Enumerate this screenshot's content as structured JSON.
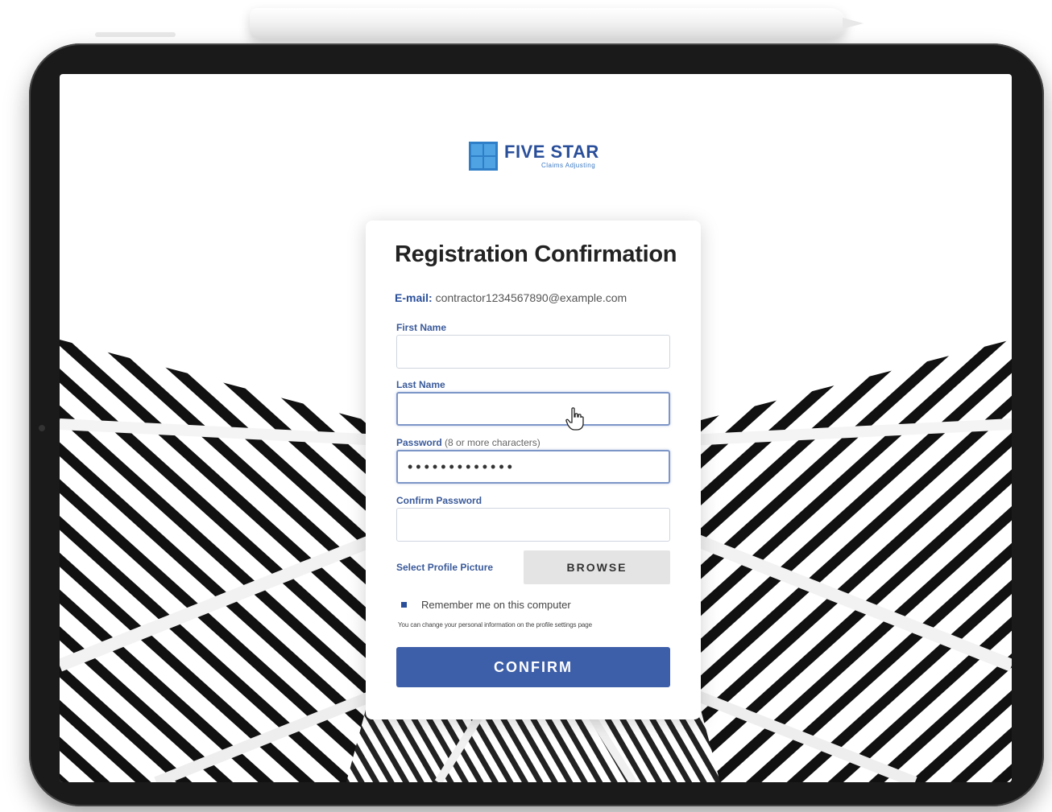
{
  "brand": {
    "name": "FIVE STAR",
    "tagline": "Claims Adjusting",
    "primary_color": "#2a4f9a",
    "accent_color": "#3d5ea8"
  },
  "form": {
    "title": "Registration Confirmation",
    "email_label": "E-mail:",
    "email_value": "contractor1234567890@example.com",
    "first_name_label": "First Name",
    "first_name_value": "",
    "last_name_label": "Last Name",
    "last_name_value": "",
    "password_label": "Password",
    "password_hint": "(8 or more characters)",
    "password_value": "•••••••••••••",
    "confirm_password_label": "Confirm Password",
    "confirm_password_value": "",
    "profile_picture_label": "Select Profile Picture",
    "browse_label": "BROWSE",
    "remember_label": "Remember me on this computer",
    "remember_checked": true,
    "note": "You can change your personal information on the profile settings page",
    "confirm_label": "CONFIRM"
  },
  "icons": {
    "cursor": "hand-pointer-icon",
    "logo": "five-star-logo-icon"
  }
}
